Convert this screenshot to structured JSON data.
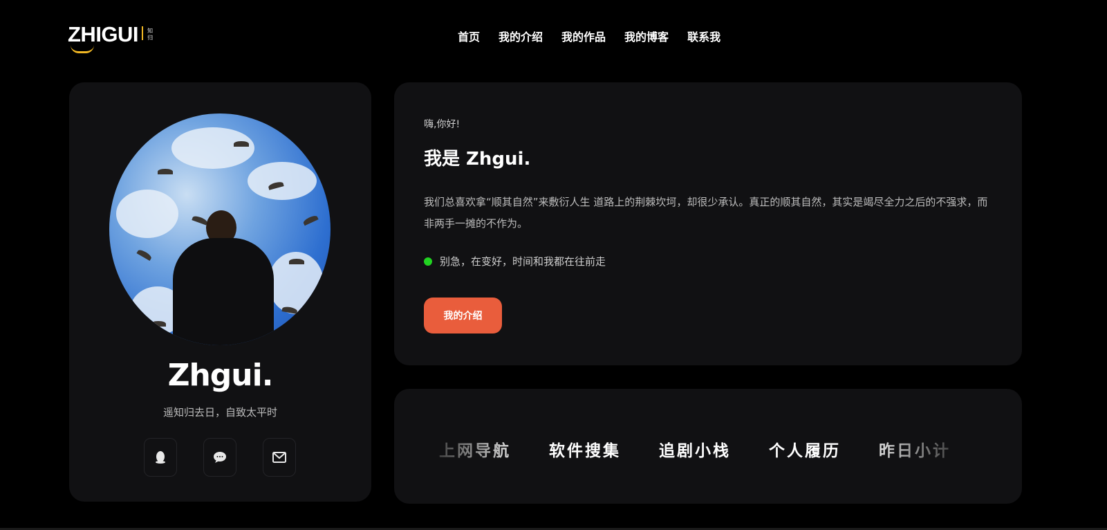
{
  "header": {
    "logo_text": "ZHIGUI",
    "logo_sub": "知归",
    "nav": [
      "首页",
      "我的介绍",
      "我的作品",
      "我的博客",
      "联系我"
    ]
  },
  "profile": {
    "name": "Zhgui.",
    "motto": "遥知归去日，自致太平时",
    "socials": [
      "qq-icon",
      "chat-icon",
      "mail-icon"
    ]
  },
  "intro": {
    "greeting": "嗨,你好!",
    "headline": "我是 Zhgui.",
    "paragraph": "我们总喜欢拿“顺其自然”来敷衍人生 道路上的荆棘坎坷，却很少承认。真正的顺其自然，其实是竭尽全力之后的不强求，而非两手一摊的不作为。",
    "status": "别急，在变好，时间和我都在往前走",
    "status_color": "#21d321",
    "button": "我的介绍",
    "button_color": "#e95d3c"
  },
  "links": [
    "上网导航",
    "软件搜集",
    "追剧小栈",
    "个人履历",
    "昨日小计"
  ]
}
